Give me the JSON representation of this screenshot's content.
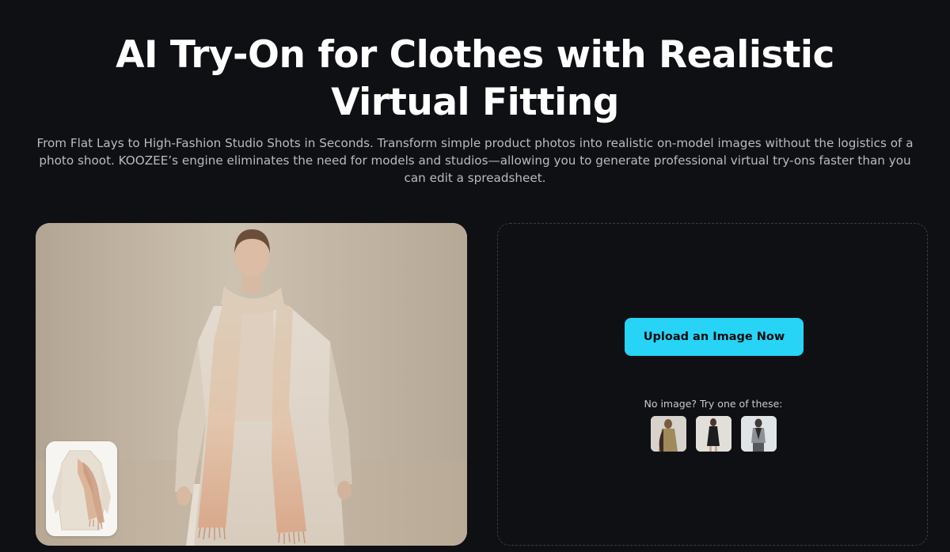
{
  "hero": {
    "title_line1": "AI Try-On for Clothes with Realistic",
    "title_line2": "Virtual Fitting",
    "subtitle": "From Flat Lays to High-Fashion Studio Shots in Seconds. Transform simple product photos into realistic on-model images without the logistics of a photo shoot. KOOZEE’s engine eliminates the need for models and studios—allowing you to generate professional virtual try-ons faster than you can edit a spreadsheet."
  },
  "upload": {
    "button_label": "Upload an Image Now",
    "sample_hint": "No image? Try one of these:",
    "samples": [
      {
        "icon": "model-in-olive-jacket"
      },
      {
        "icon": "model-in-black-dress"
      },
      {
        "icon": "model-in-grey-top"
      }
    ]
  },
  "colors": {
    "background": "#0f1013",
    "accent": "#27d4f5",
    "subtitle_text": "#b9bbc0"
  }
}
